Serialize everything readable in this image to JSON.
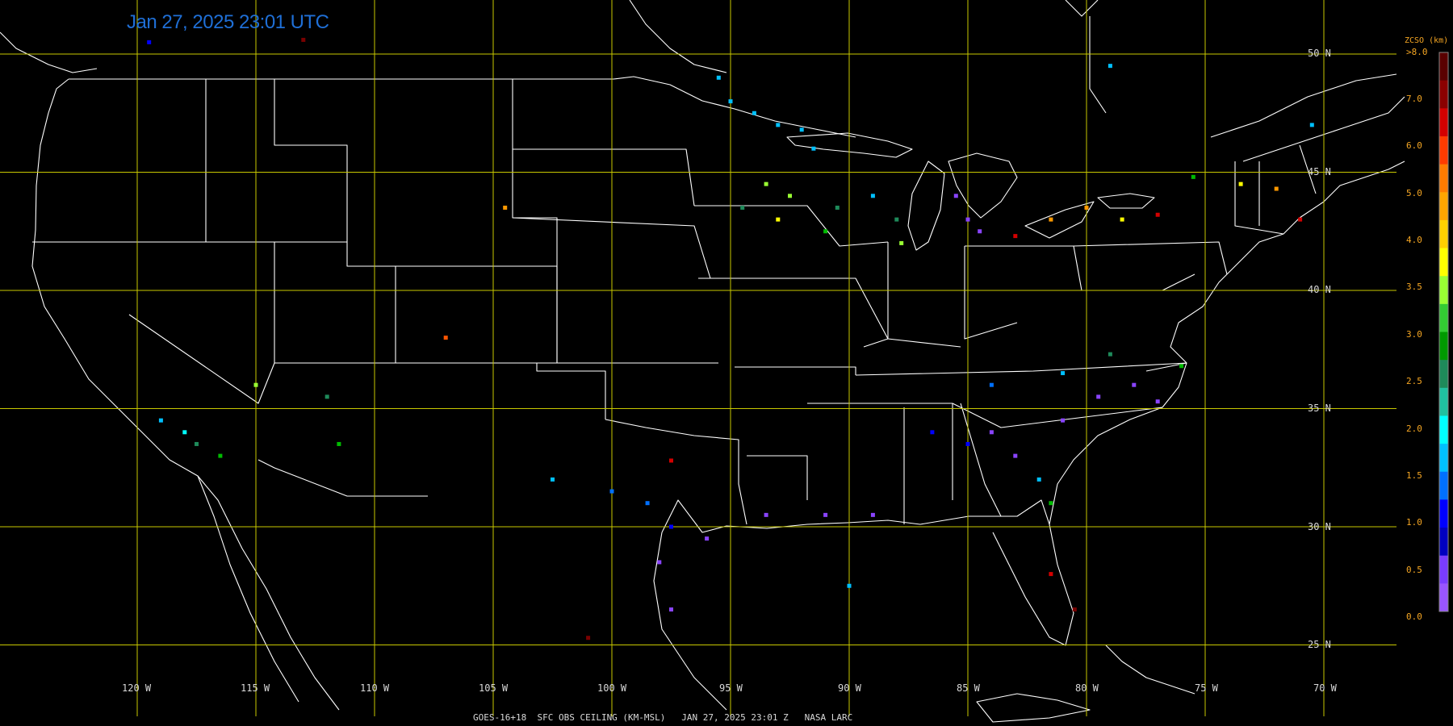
{
  "title": "Jan 27, 2025 23:01 UTC",
  "footer": "GOES-16+18  SFC OBS CEILING (KM-MSL)   JAN 27, 2025 23:01 Z   NASA LARC",
  "colors": {
    "background": "#000000",
    "grid": "#c8c800",
    "boundary": "#ffffff",
    "title": "#1f6fd6",
    "colorbar_text": "#f5a623"
  },
  "latitude_labels": [
    "50 N",
    "45 N",
    "40 N",
    "35 N",
    "30 N",
    "25 N"
  ],
  "longitude_labels": [
    "120 W",
    "115 W",
    "110 W",
    "105 W",
    "100 W",
    "95 W",
    "90 W",
    "85 W",
    "80 W",
    "75 W",
    "70 W"
  ],
  "colorbar": {
    "title": "ZCSO (km)",
    "top_label": ">8.0",
    "labels": [
      "7.0",
      "6.0",
      "5.0",
      "4.0",
      "3.5",
      "3.0",
      "2.5",
      "2.0",
      "1.5",
      "1.0",
      "0.5",
      "0.0"
    ],
    "colors": [
      "#5a0000",
      "#8b0000",
      "#d40000",
      "#ff3b00",
      "#ff7b00",
      "#ffa500",
      "#ffd000",
      "#ffff00",
      "#99ff33",
      "#33cc33",
      "#009900",
      "#1e8a5a",
      "#20c0a0",
      "#00ffff",
      "#00c0ff",
      "#0070ff",
      "#0000ff",
      "#0000c0",
      "#7a3cff",
      "#9955ff"
    ]
  },
  "chart_data": {
    "type": "scatter",
    "title": "Jan 27, 2025 23:01 UTC",
    "xlabel": "Longitude",
    "ylabel": "Latitude",
    "xlim": [
      -122.3,
      -67.2
    ],
    "ylim": [
      24.3,
      51.2
    ],
    "grid": true,
    "legend": "colorbar-right",
    "colorbar_title": "ZCSO (km)",
    "colorbar_labels": [
      ">8.0",
      "7.0",
      "6.0",
      "5.0",
      "4.0",
      "3.5",
      "3.0",
      "2.5",
      "2.0",
      "1.5",
      "1.0",
      "0.5",
      "0.0"
    ],
    "series": [
      {
        "name": "",
        "points": [
          {
            "lon": -95.5,
            "lat": 49.0,
            "km": 1.5
          },
          {
            "lon": -95.0,
            "lat": 48.0,
            "km": 1.5
          },
          {
            "lon": -94.0,
            "lat": 47.5,
            "km": 1.5
          },
          {
            "lon": -93.0,
            "lat": 47.0,
            "km": 1.5
          },
          {
            "lon": -92.0,
            "lat": 46.8,
            "km": 1.5
          },
          {
            "lon": -91.5,
            "lat": 46.0,
            "km": 1.5
          },
          {
            "lon": -93.5,
            "lat": 44.5,
            "km": 3.5
          },
          {
            "lon": -92.5,
            "lat": 44.0,
            "km": 3.5
          },
          {
            "lon": -94.5,
            "lat": 43.5,
            "km": 2.5
          },
          {
            "lon": -93.0,
            "lat": 43.0,
            "km": 4.0
          },
          {
            "lon": -91.0,
            "lat": 42.5,
            "km": 3.0
          },
          {
            "lon": -90.5,
            "lat": 43.5,
            "km": 2.5
          },
          {
            "lon": -89.0,
            "lat": 44.0,
            "km": 1.5
          },
          {
            "lon": -88.0,
            "lat": 43.0,
            "km": 2.5
          },
          {
            "lon": -87.8,
            "lat": 42.0,
            "km": 3.5
          },
          {
            "lon": -85.5,
            "lat": 44.0,
            "km": 0.0
          },
          {
            "lon": -85.0,
            "lat": 43.0,
            "km": 0.0
          },
          {
            "lon": -84.5,
            "lat": 42.5,
            "km": 0.0
          },
          {
            "lon": -83.0,
            "lat": 42.3,
            "km": 7.0
          },
          {
            "lon": -81.5,
            "lat": 43.0,
            "km": 5.0
          },
          {
            "lon": -80.0,
            "lat": 43.5,
            "km": 4.5
          },
          {
            "lon": -78.5,
            "lat": 43.0,
            "km": 4.0
          },
          {
            "lon": -77.0,
            "lat": 43.2,
            "km": 6.5
          },
          {
            "lon": -75.5,
            "lat": 44.8,
            "km": 3.0
          },
          {
            "lon": -73.5,
            "lat": 44.5,
            "km": 4.0
          },
          {
            "lon": -72.0,
            "lat": 44.3,
            "km": 4.5
          },
          {
            "lon": -71.0,
            "lat": 43.0,
            "km": 7.0
          },
          {
            "lon": -119.0,
            "lat": 34.5,
            "km": 1.5
          },
          {
            "lon": -118.0,
            "lat": 34.0,
            "km": 2.0
          },
          {
            "lon": -117.5,
            "lat": 33.5,
            "km": 2.5
          },
          {
            "lon": -116.5,
            "lat": 33.0,
            "km": 3.0
          },
          {
            "lon": -115.0,
            "lat": 36.0,
            "km": 3.5
          },
          {
            "lon": -112.0,
            "lat": 35.5,
            "km": 2.5
          },
          {
            "lon": -111.5,
            "lat": 33.5,
            "km": 3.0
          },
          {
            "lon": -104.5,
            "lat": 43.5,
            "km": 4.5
          },
          {
            "lon": -107.0,
            "lat": 38.0,
            "km": 6.0
          },
          {
            "lon": -102.5,
            "lat": 32.0,
            "km": 1.5
          },
          {
            "lon": -100.0,
            "lat": 31.5,
            "km": 1.0
          },
          {
            "lon": -98.5,
            "lat": 31.0,
            "km": 1.0
          },
          {
            "lon": -97.5,
            "lat": 30.0,
            "km": 0.5
          },
          {
            "lon": -96.0,
            "lat": 29.5,
            "km": 0.0
          },
          {
            "lon": -98.0,
            "lat": 28.5,
            "km": 0.0
          },
          {
            "lon": -97.5,
            "lat": 26.5,
            "km": 0.0
          },
          {
            "lon": -97.5,
            "lat": 32.8,
            "km": 7.0
          },
          {
            "lon": -93.5,
            "lat": 30.5,
            "km": 0.0
          },
          {
            "lon": -91.0,
            "lat": 30.5,
            "km": 0.0
          },
          {
            "lon": -89.0,
            "lat": 30.5,
            "km": 0.0
          },
          {
            "lon": -90.0,
            "lat": 27.5,
            "km": 1.5
          },
          {
            "lon": -86.5,
            "lat": 34.0,
            "km": 0.5
          },
          {
            "lon": -85.0,
            "lat": 33.5,
            "km": 0.5
          },
          {
            "lon": -84.0,
            "lat": 34.0,
            "km": 0.0
          },
          {
            "lon": -83.0,
            "lat": 33.0,
            "km": 0.0
          },
          {
            "lon": -82.0,
            "lat": 32.0,
            "km": 1.5
          },
          {
            "lon": -81.5,
            "lat": 31.0,
            "km": 3.0
          },
          {
            "lon": -81.0,
            "lat": 34.5,
            "km": 0.0
          },
          {
            "lon": -79.5,
            "lat": 35.5,
            "km": 0.0
          },
          {
            "lon": -78.0,
            "lat": 36.0,
            "km": 0.0
          },
          {
            "lon": -77.0,
            "lat": 35.3,
            "km": 0.0
          },
          {
            "lon": -76.0,
            "lat": 36.8,
            "km": 3.0
          },
          {
            "lon": -79.0,
            "lat": 37.3,
            "km": 2.5
          },
          {
            "lon": -81.0,
            "lat": 36.5,
            "km": 1.5
          },
          {
            "lon": -84.0,
            "lat": 36.0,
            "km": 1.0
          },
          {
            "lon": -81.5,
            "lat": 28.0,
            "km": 7.0
          },
          {
            "lon": -80.5,
            "lat": 26.5,
            "km": 7.5
          },
          {
            "lon": -101.0,
            "lat": 25.3,
            "km": 7.5
          },
          {
            "lon": -119.5,
            "lat": 50.5,
            "km": 0.5
          },
          {
            "lon": -113.0,
            "lat": 50.6,
            "km": 7.5
          },
          {
            "lon": -79.0,
            "lat": 49.5,
            "km": 1.5
          },
          {
            "lon": -70.5,
            "lat": 47.0,
            "km": 1.5
          }
        ]
      }
    ]
  }
}
